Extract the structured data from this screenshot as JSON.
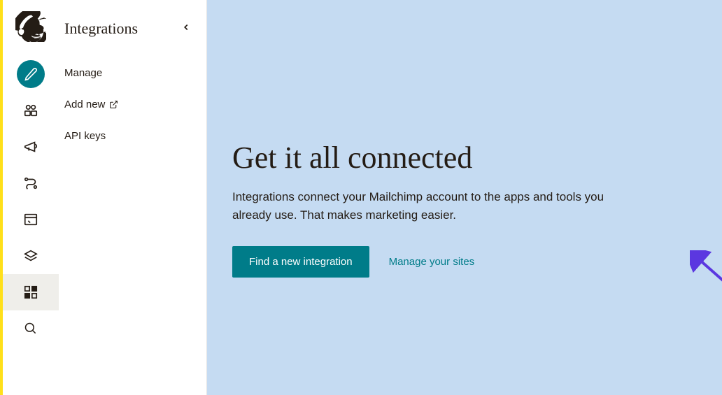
{
  "sidebar": {
    "title": "Integrations",
    "items": [
      {
        "label": "Manage",
        "external": false
      },
      {
        "label": "Add new",
        "external": true
      },
      {
        "label": "API keys",
        "external": false
      }
    ]
  },
  "main": {
    "heading": "Get it all connected",
    "description": "Integrations connect your Mailchimp account to the apps and tools you already use. That makes marketing easier.",
    "primary_cta": "Find a new integration",
    "secondary_link": "Manage your sites"
  },
  "colors": {
    "accent": "#007c89",
    "hero_bg": "#c5dbf2",
    "brand_yellow": "#ffe01b"
  }
}
